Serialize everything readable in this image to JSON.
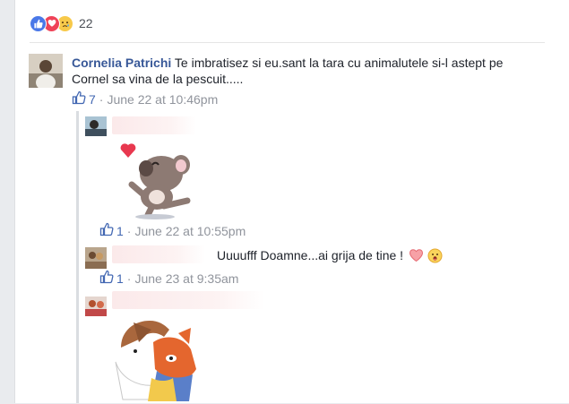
{
  "reactions": {
    "icons": [
      "like-icon",
      "love-icon",
      "sad-icon"
    ],
    "count": "22"
  },
  "comments": [
    {
      "author": "Cornelia Patrichi",
      "text": " Te imbratisez si eu.sant la tara cu animalutele si-l astept pe Cornel sa vina de la pescuit.....",
      "likes": "7",
      "time": "June 22 at 10:46pm"
    }
  ],
  "replies": [
    {
      "sticker": "koala-blowing-kiss-sticker",
      "likes": "1",
      "time": "June 22 at 10:55pm"
    },
    {
      "text": "Uuuufff Doamne...ai grija de tine !",
      "emojis": [
        "heart-icon",
        "face-emoji-icon"
      ],
      "likes": "1",
      "time": "June 23 at 9:35am"
    },
    {
      "sticker": "fox-and-dog-hug-sticker"
    }
  ],
  "colors": {
    "link": "#385898",
    "meta": "#90949c",
    "like_blue": "#4267b2",
    "love_red": "#ef4358"
  },
  "separator": "·"
}
